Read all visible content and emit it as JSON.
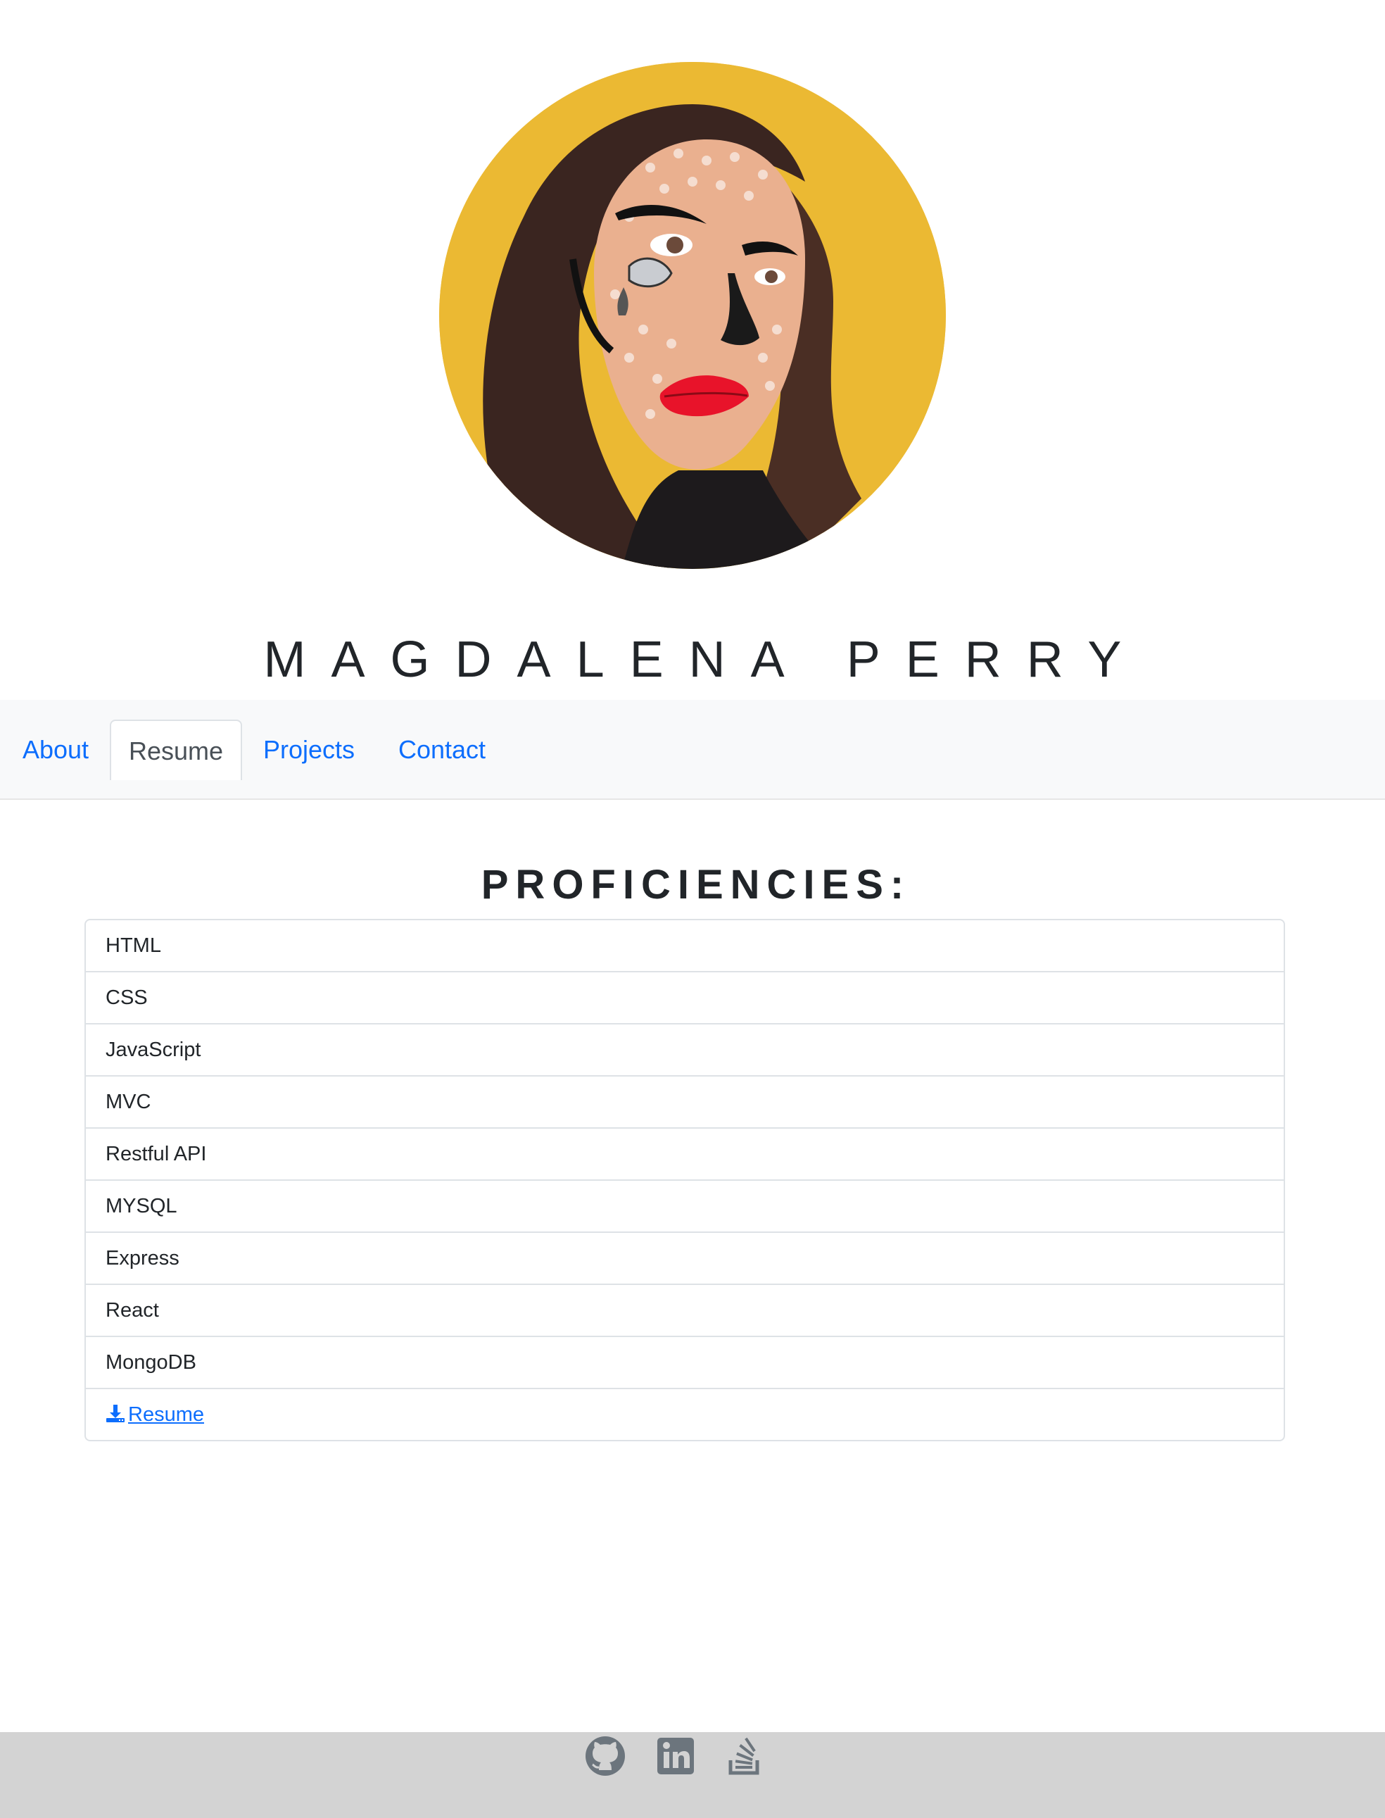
{
  "profile": {
    "name": "MAGDALENA PERRY",
    "avatar_alt": "pop-art portrait"
  },
  "nav": {
    "tabs": [
      {
        "label": "About",
        "active": false
      },
      {
        "label": "Resume",
        "active": true
      },
      {
        "label": "Projects",
        "active": false
      },
      {
        "label": "Contact",
        "active": false
      }
    ]
  },
  "resume": {
    "title": "PROFICIENCIES:",
    "skills": [
      "HTML",
      "CSS",
      "JavaScript",
      "MVC",
      "Restful API",
      "MYSQL",
      "Express",
      "React",
      "MongoDB"
    ],
    "download_label": "Resume",
    "download_icon": "download-icon"
  },
  "footer": {
    "icons": [
      "github-icon",
      "linkedin-icon",
      "stack-overflow-icon"
    ]
  },
  "colors": {
    "link": "#0d6efd",
    "avatar_bg": "#ebb933",
    "navbar_bg": "#f8f9fa",
    "footer_bg": "#d3d3d3",
    "icon": "#6c757d"
  }
}
